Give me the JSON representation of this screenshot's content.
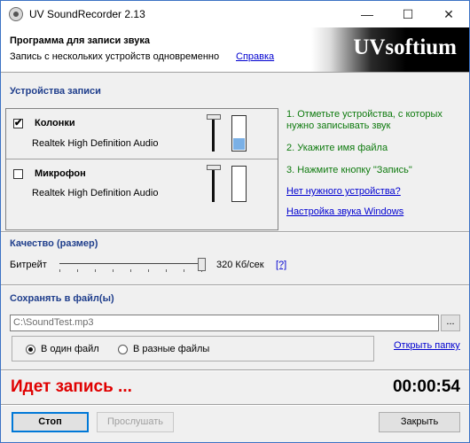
{
  "window": {
    "title": "UV SoundRecorder 2.13",
    "minimize_glyph": "—",
    "maximize_glyph": "☐",
    "close_glyph": "✕"
  },
  "header": {
    "title": "Программа для записи звука",
    "subtitle": "Запись с нескольких устройств одновременно",
    "help_link": "Справка",
    "logo": "UVsoftium"
  },
  "devices": {
    "section_title": "Устройства записи",
    "items": [
      {
        "name": "Колонки",
        "driver": "Realtek High Definition Audio",
        "checked": true,
        "check_glyph": "✔",
        "level": 0.35
      },
      {
        "name": "Микрофон",
        "driver": "Realtek High Definition Audio",
        "checked": false,
        "check_glyph": "",
        "level": 0
      }
    ],
    "instructions": [
      "1. Отметьте устройства, с которых нужно записывать звук",
      "2. Укажите имя файла",
      "3. Нажмите кнопку \"Запись\""
    ],
    "no_device_link": "Нет нужного устройства?",
    "sound_settings_link": "Настройка звука Windows"
  },
  "quality": {
    "section_title": "Качество (размер)",
    "bitrate_label": "Битрейт",
    "bitrate_value": "320 Кб/сек",
    "help_link": "[?]"
  },
  "save": {
    "section_title": "Сохранять в файл(ы)",
    "file_path": "C:\\SoundTest.mp3",
    "browse_label": "...",
    "option_single": "В один файл",
    "option_multiple": "В разные файлы",
    "selected_option": "single",
    "open_folder_link": "Открыть папку"
  },
  "status": {
    "recording_text": "Идет запись ...",
    "timer": "00:00:54"
  },
  "buttons": {
    "stop": "Стоп",
    "play": "Прослушать",
    "close": "Закрыть"
  },
  "colors": {
    "accent_link": "#0000d0",
    "instruction_text": "#0e7a0e",
    "section_title": "#1f3e8c",
    "recording_status": "#e00000",
    "meter_fill": "#7ab0e6"
  }
}
